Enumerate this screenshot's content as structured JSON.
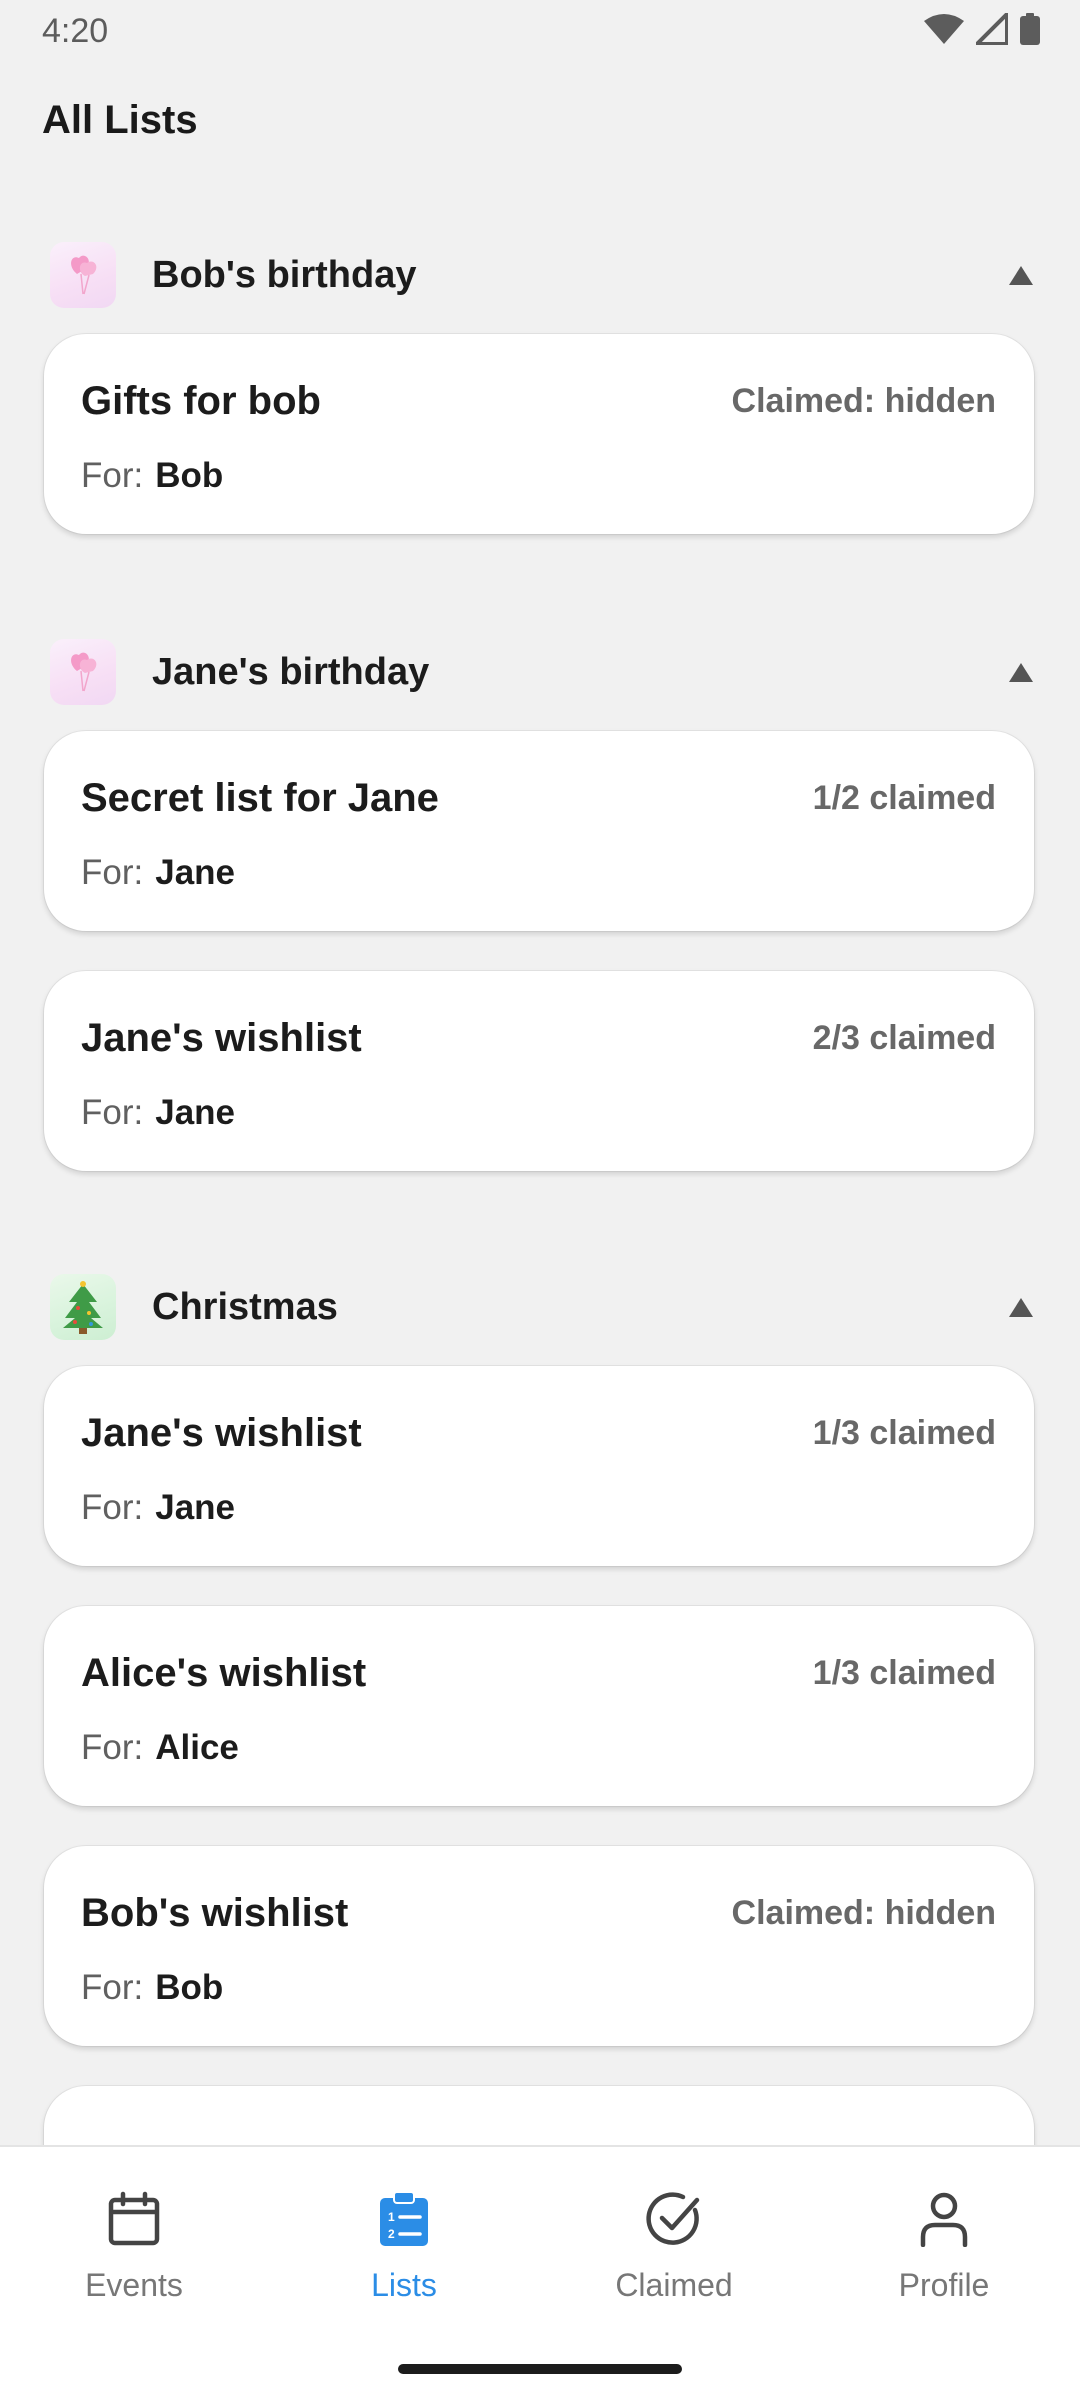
{
  "status_bar": {
    "time": "4:20",
    "icons": [
      "wifi-icon",
      "signal-icon",
      "battery-icon"
    ]
  },
  "page": {
    "title": "All Lists"
  },
  "events": [
    {
      "name": "Bob's birthday",
      "icon": "balloon-icon",
      "lists": [
        {
          "title": "Gifts for bob",
          "status": "Claimed: hidden",
          "for_label": "For:",
          "for_name": "Bob"
        }
      ]
    },
    {
      "name": "Jane's birthday",
      "icon": "balloon-icon",
      "lists": [
        {
          "title": "Secret list for Jane",
          "status": "1/2 claimed",
          "for_label": "For:",
          "for_name": "Jane"
        },
        {
          "title": "Jane's wishlist",
          "status": "2/3 claimed",
          "for_label": "For:",
          "for_name": "Jane"
        }
      ]
    },
    {
      "name": "Christmas",
      "icon": "christmas-tree-icon",
      "lists": [
        {
          "title": "Jane's wishlist",
          "status": "1/3 claimed",
          "for_label": "For:",
          "for_name": "Jane"
        },
        {
          "title": "Alice's wishlist",
          "status": "1/3 claimed",
          "for_label": "For:",
          "for_name": "Alice"
        },
        {
          "title": "Bob's wishlist",
          "status": "Claimed: hidden",
          "for_label": "For:",
          "for_name": "Bob"
        }
      ]
    }
  ],
  "bottom_nav": {
    "active": "Lists",
    "accent_color": "#2b8de6",
    "items": [
      {
        "label": "Events",
        "icon": "calendar-icon"
      },
      {
        "label": "Lists",
        "icon": "clipboard-list-icon"
      },
      {
        "label": "Claimed",
        "icon": "check-circle-icon"
      },
      {
        "label": "Profile",
        "icon": "person-icon"
      }
    ]
  }
}
